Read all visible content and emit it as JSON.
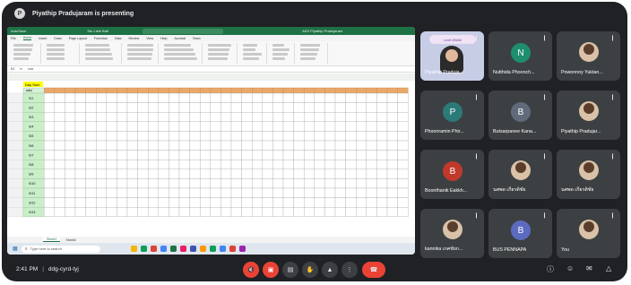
{
  "presenting_bar": {
    "avatar_letter": "P",
    "text": "Piyathip Pradujaram is presenting"
  },
  "excel": {
    "title_left": "AutoSave",
    "title_file": "Stu Liste Ba5",
    "title_user": "AKS Piyathip Pradujaram",
    "menu": [
      "File",
      "Home",
      "Insert",
      "Draw",
      "Page Layout",
      "Formulas",
      "Data",
      "Review",
      "View",
      "Help",
      "Acrobat",
      "Team"
    ],
    "active_menu": "Home",
    "cell_ref": "B3",
    "formula": "sdsi",
    "sheet_label": "Day Sum",
    "header_cell": "sdsi",
    "row_ids": [
      "S/1",
      "S/2",
      "S/3",
      "S/4",
      "S/5",
      "S/6",
      "S/7",
      "S/8",
      "S/9",
      "S/10",
      "S/11",
      "S/12",
      "S/13"
    ],
    "sheet_tabs": [
      "Sheet1",
      "Sheet2"
    ],
    "active_tab": "Sheet1",
    "taskbar_search": "Type here to search"
  },
  "participants": [
    {
      "name": "Piyathip Praduja...",
      "type": "video",
      "banner": "Leaf 2BAM"
    },
    {
      "name": "Nutthida Phoonch...",
      "type": "avatar",
      "letter": "N",
      "color": "#1e8e6e"
    },
    {
      "name": "Powonnoy Yuktan...",
      "type": "photo"
    },
    {
      "name": "Phoonramin Phir...",
      "type": "avatar",
      "letter": "P",
      "color": "#2b7a78"
    },
    {
      "name": "Butsarpanee Kana...",
      "type": "avatar",
      "letter": "B",
      "color": "#5f6b7a"
    },
    {
      "name": "Piyathip Pradujar...",
      "type": "photo"
    },
    {
      "name": "Boonthanik Eakkh...",
      "type": "avatar",
      "letter": "B",
      "color": "#c0392b"
    },
    {
      "name": "นศพด เกียรติชัย",
      "type": "photo"
    },
    {
      "name": "นศพด เกียรติชัย",
      "type": "photo"
    },
    {
      "name": "kannika เกศชัยก...",
      "type": "photo"
    },
    {
      "name": "BUS PENNAPA",
      "type": "avatar",
      "letter": "B",
      "color": "#5c6bc0"
    },
    {
      "name": "You",
      "type": "photo"
    }
  ],
  "bottom": {
    "time": "2:41 PM",
    "meeting_code": "ddg-cyrd-tyj",
    "controls": [
      "mic-off-icon",
      "camera-off-icon",
      "captions-icon",
      "raise-hand-icon",
      "present-icon",
      "more-icon",
      "leave-call-icon"
    ],
    "right_controls": [
      "info-icon",
      "people-icon",
      "chat-icon",
      "activities-icon"
    ]
  }
}
